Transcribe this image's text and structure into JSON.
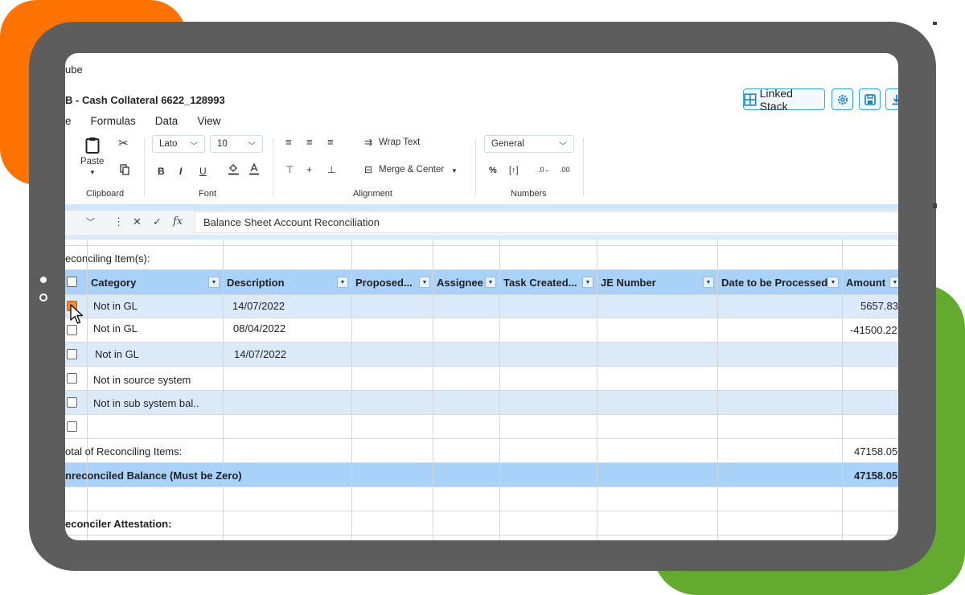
{
  "app": {
    "name_fragment": "ube",
    "doc_title": "B - Cash Collateral 6622_128993"
  },
  "top_buttons": {
    "linked_stack": "Linked Stack",
    "settings_icon": "gear-icon",
    "save_icon": "save-icon",
    "download_icon": "download-icon"
  },
  "menu": [
    "e",
    "Formulas",
    "Data",
    "View"
  ],
  "ribbon": {
    "clipboard": {
      "paste": "Paste",
      "label": "Clipboard"
    },
    "font": {
      "family": "Lato",
      "size": "10",
      "label": "Font",
      "bold": "B",
      "italic": "I",
      "underline": "U"
    },
    "alignment": {
      "wrap_text": "Wrap Text",
      "merge_center": "Merge & Center",
      "label": "Alignment"
    },
    "numbers": {
      "format": "General",
      "label": "Numbers"
    }
  },
  "formula_bar": {
    "value": "Balance Sheet Account Reconciliation"
  },
  "sheet": {
    "section_reconciling": "econciling Item(s):",
    "headers": [
      "Category",
      "Description",
      "Proposed...",
      "Assignee",
      "Task Created...",
      "JE Number",
      "Date to be Processed",
      "Amount"
    ],
    "rows": [
      {
        "category": "Not in GL",
        "description": "14/07/2022",
        "amount": "5657.83",
        "checked": true
      },
      {
        "category": "Not in GL",
        "description": "08/04/2022",
        "amount": "-41500.22",
        "checked": false
      },
      {
        "category": "Not in GL",
        "description": "14/07/2022",
        "amount": "",
        "checked": false
      },
      {
        "category": "Not in source system",
        "description": "",
        "amount": "",
        "checked": false
      },
      {
        "category": "Not in sub system bal..",
        "description": "",
        "amount": "",
        "checked": false
      },
      {
        "category": "",
        "description": "",
        "amount": "",
        "checked": false
      }
    ],
    "total_label": "otal of Reconciling Items:",
    "total_value": "47158.05",
    "unreconciled_label": "nreconciled Balance (Must be Zero)",
    "unreconciled_value": "47158.05",
    "attestation_label": "econciler Attestation:"
  },
  "colors": {
    "orange": "#fd7200",
    "green": "#63ab2e",
    "tablet": "#5d5d5d",
    "header_blue": "#a9d2f8",
    "band_blue": "#dbeaf9",
    "accent": "#3aa4dc"
  }
}
